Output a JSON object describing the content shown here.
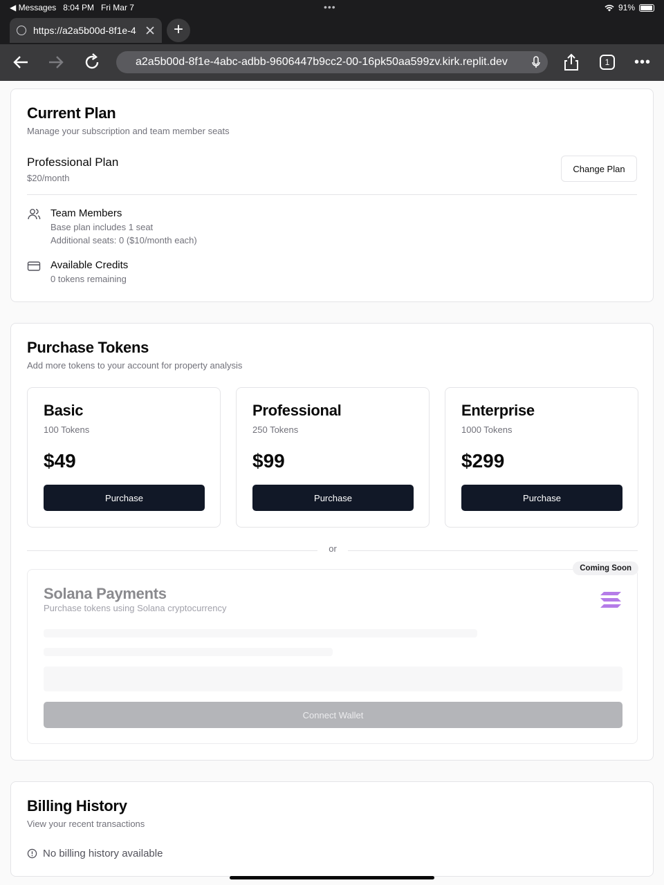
{
  "status": {
    "back_app": "◀ Messages",
    "time": "8:04 PM",
    "date": "Fri Mar 7",
    "dots": "•••",
    "battery": "91%"
  },
  "browser": {
    "tab_title": "https://a2a5b00d-8f1e-4",
    "new_tab": "+",
    "url": "a2a5b00d-8f1e-4abc-adbb-9606447b9cc2-00-16pk50aa599zv.kirk.replit.dev",
    "tab_count": "1"
  },
  "current_plan": {
    "title": "Current Plan",
    "subtitle": "Manage your subscription and team member seats",
    "plan_name": "Professional Plan",
    "plan_price": "$20/month",
    "change_button": "Change Plan",
    "team": {
      "title": "Team Members",
      "line1": "Base plan includes 1 seat",
      "line2": "Additional seats: 0 ($10/month each)"
    },
    "credits": {
      "title": "Available Credits",
      "line1": "0 tokens remaining"
    }
  },
  "purchase": {
    "title": "Purchase Tokens",
    "subtitle": "Add more tokens to your account for property analysis",
    "tiers": [
      {
        "name": "Basic",
        "tokens": "100 Tokens",
        "price": "$49",
        "button": "Purchase"
      },
      {
        "name": "Professional",
        "tokens": "250 Tokens",
        "price": "$99",
        "button": "Purchase"
      },
      {
        "name": "Enterprise",
        "tokens": "1000 Tokens",
        "price": "$299",
        "button": "Purchase"
      }
    ],
    "or_text": "or",
    "solana": {
      "badge": "Coming Soon",
      "title": "Solana Payments",
      "subtitle": "Purchase tokens using Solana cryptocurrency",
      "connect_button": "Connect Wallet"
    }
  },
  "billing": {
    "title": "Billing History",
    "subtitle": "View your recent transactions",
    "empty": "No billing history available"
  },
  "colors": {
    "primary_button": "#111827",
    "disabled_button": "#b4b5b9",
    "solana_accent": "#b57ce8"
  }
}
